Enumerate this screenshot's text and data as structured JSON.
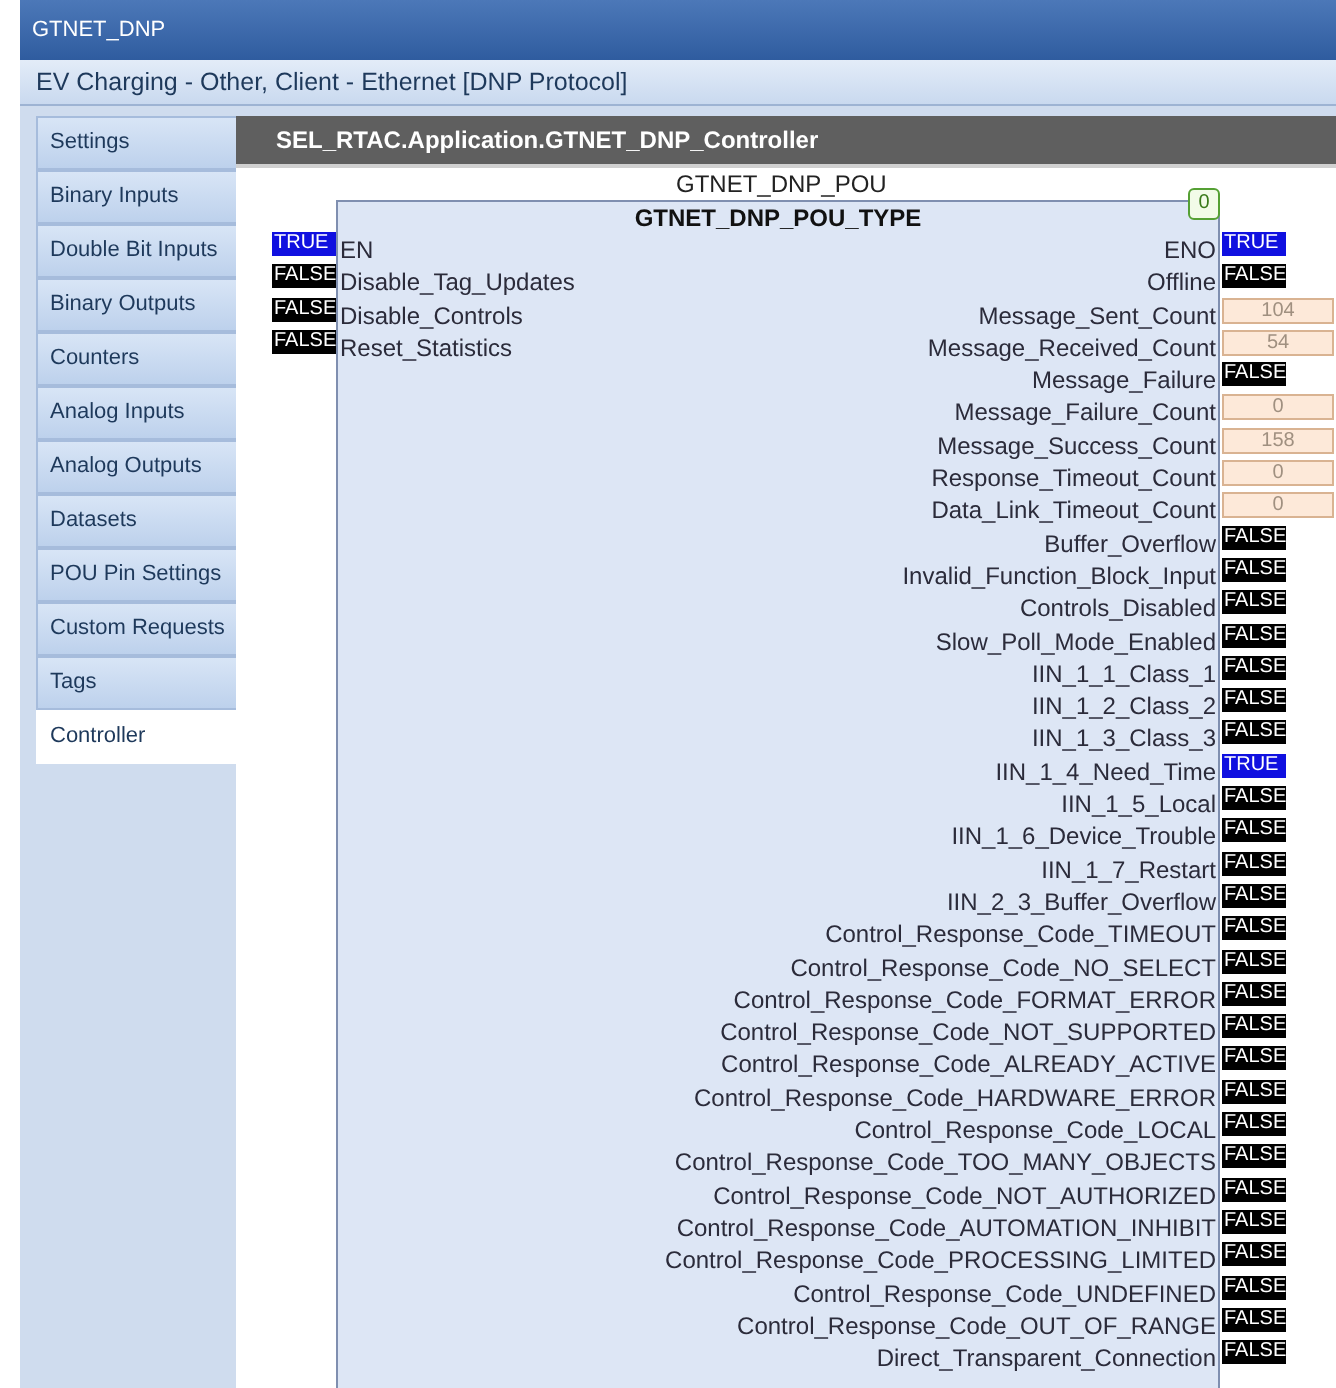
{
  "window": {
    "title": "GTNET_DNP"
  },
  "subtitle": "EV Charging - Other, Client - Ethernet  [DNP Protocol]",
  "sidebar": {
    "items": [
      {
        "label": "Settings",
        "selected": false
      },
      {
        "label": "Binary Inputs",
        "selected": false
      },
      {
        "label": "Double Bit Inputs",
        "selected": false
      },
      {
        "label": "Binary Outputs",
        "selected": false
      },
      {
        "label": "Counters",
        "selected": false
      },
      {
        "label": "Analog Inputs",
        "selected": false
      },
      {
        "label": "Analog Outputs",
        "selected": false
      },
      {
        "label": "Datasets",
        "selected": false
      },
      {
        "label": "POU Pin Settings",
        "selected": false
      },
      {
        "label": "Custom Requests",
        "selected": false
      },
      {
        "label": "Tags",
        "selected": false
      },
      {
        "label": "Controller",
        "selected": true
      }
    ]
  },
  "panel": {
    "title": "SEL_RTAC.Application.GTNET_DNP_Controller",
    "block": {
      "instance": "GTNET_DNP_POU",
      "type": "GTNET_DNP_POU_TYPE",
      "badge": "0",
      "inputs": [
        {
          "name": "EN",
          "kind": "bool",
          "value": "TRUE"
        },
        {
          "name": "Disable_Tag_Updates",
          "kind": "bool",
          "value": "FALSE"
        },
        {
          "name": "Disable_Controls",
          "kind": "bool",
          "value": "FALSE"
        },
        {
          "name": "Reset_Statistics",
          "kind": "bool",
          "value": "FALSE"
        }
      ],
      "outputs": [
        {
          "name": "ENO",
          "kind": "bool",
          "value": "TRUE"
        },
        {
          "name": "Offline",
          "kind": "bool",
          "value": "FALSE"
        },
        {
          "name": "Message_Sent_Count",
          "kind": "number",
          "value": "104"
        },
        {
          "name": "Message_Received_Count",
          "kind": "number",
          "value": "54"
        },
        {
          "name": "Message_Failure",
          "kind": "bool",
          "value": "FALSE"
        },
        {
          "name": "Message_Failure_Count",
          "kind": "number",
          "value": "0"
        },
        {
          "name": "Message_Success_Count",
          "kind": "number",
          "value": "158"
        },
        {
          "name": "Response_Timeout_Count",
          "kind": "number",
          "value": "0"
        },
        {
          "name": "Data_Link_Timeout_Count",
          "kind": "number",
          "value": "0"
        },
        {
          "name": "Buffer_Overflow",
          "kind": "bool",
          "value": "FALSE"
        },
        {
          "name": "Invalid_Function_Block_Input",
          "kind": "bool",
          "value": "FALSE"
        },
        {
          "name": "Controls_Disabled",
          "kind": "bool",
          "value": "FALSE"
        },
        {
          "name": "Slow_Poll_Mode_Enabled",
          "kind": "bool",
          "value": "FALSE"
        },
        {
          "name": "IIN_1_1_Class_1",
          "kind": "bool",
          "value": "FALSE"
        },
        {
          "name": "IIN_1_2_Class_2",
          "kind": "bool",
          "value": "FALSE"
        },
        {
          "name": "IIN_1_3_Class_3",
          "kind": "bool",
          "value": "FALSE"
        },
        {
          "name": "IIN_1_4_Need_Time",
          "kind": "bool",
          "value": "TRUE"
        },
        {
          "name": "IIN_1_5_Local",
          "kind": "bool",
          "value": "FALSE"
        },
        {
          "name": "IIN_1_6_Device_Trouble",
          "kind": "bool",
          "value": "FALSE"
        },
        {
          "name": "IIN_1_7_Restart",
          "kind": "bool",
          "value": "FALSE"
        },
        {
          "name": "IIN_2_3_Buffer_Overflow",
          "kind": "bool",
          "value": "FALSE"
        },
        {
          "name": "Control_Response_Code_TIMEOUT",
          "kind": "bool",
          "value": "FALSE"
        },
        {
          "name": "Control_Response_Code_NO_SELECT",
          "kind": "bool",
          "value": "FALSE"
        },
        {
          "name": "Control_Response_Code_FORMAT_ERROR",
          "kind": "bool",
          "value": "FALSE"
        },
        {
          "name": "Control_Response_Code_NOT_SUPPORTED",
          "kind": "bool",
          "value": "FALSE"
        },
        {
          "name": "Control_Response_Code_ALREADY_ACTIVE",
          "kind": "bool",
          "value": "FALSE"
        },
        {
          "name": "Control_Response_Code_HARDWARE_ERROR",
          "kind": "bool",
          "value": "FALSE"
        },
        {
          "name": "Control_Response_Code_LOCAL",
          "kind": "bool",
          "value": "FALSE"
        },
        {
          "name": "Control_Response_Code_TOO_MANY_OBJECTS",
          "kind": "bool",
          "value": "FALSE"
        },
        {
          "name": "Control_Response_Code_NOT_AUTHORIZED",
          "kind": "bool",
          "value": "FALSE"
        },
        {
          "name": "Control_Response_Code_AUTOMATION_INHIBIT",
          "kind": "bool",
          "value": "FALSE"
        },
        {
          "name": "Control_Response_Code_PROCESSING_LIMITED",
          "kind": "bool",
          "value": "FALSE"
        },
        {
          "name": "Control_Response_Code_UNDEFINED",
          "kind": "bool",
          "value": "FALSE"
        },
        {
          "name": "Control_Response_Code_OUT_OF_RANGE",
          "kind": "bool",
          "value": "FALSE"
        },
        {
          "name": "Direct_Transparent_Connection",
          "kind": "bool",
          "value": "FALSE"
        }
      ]
    }
  }
}
